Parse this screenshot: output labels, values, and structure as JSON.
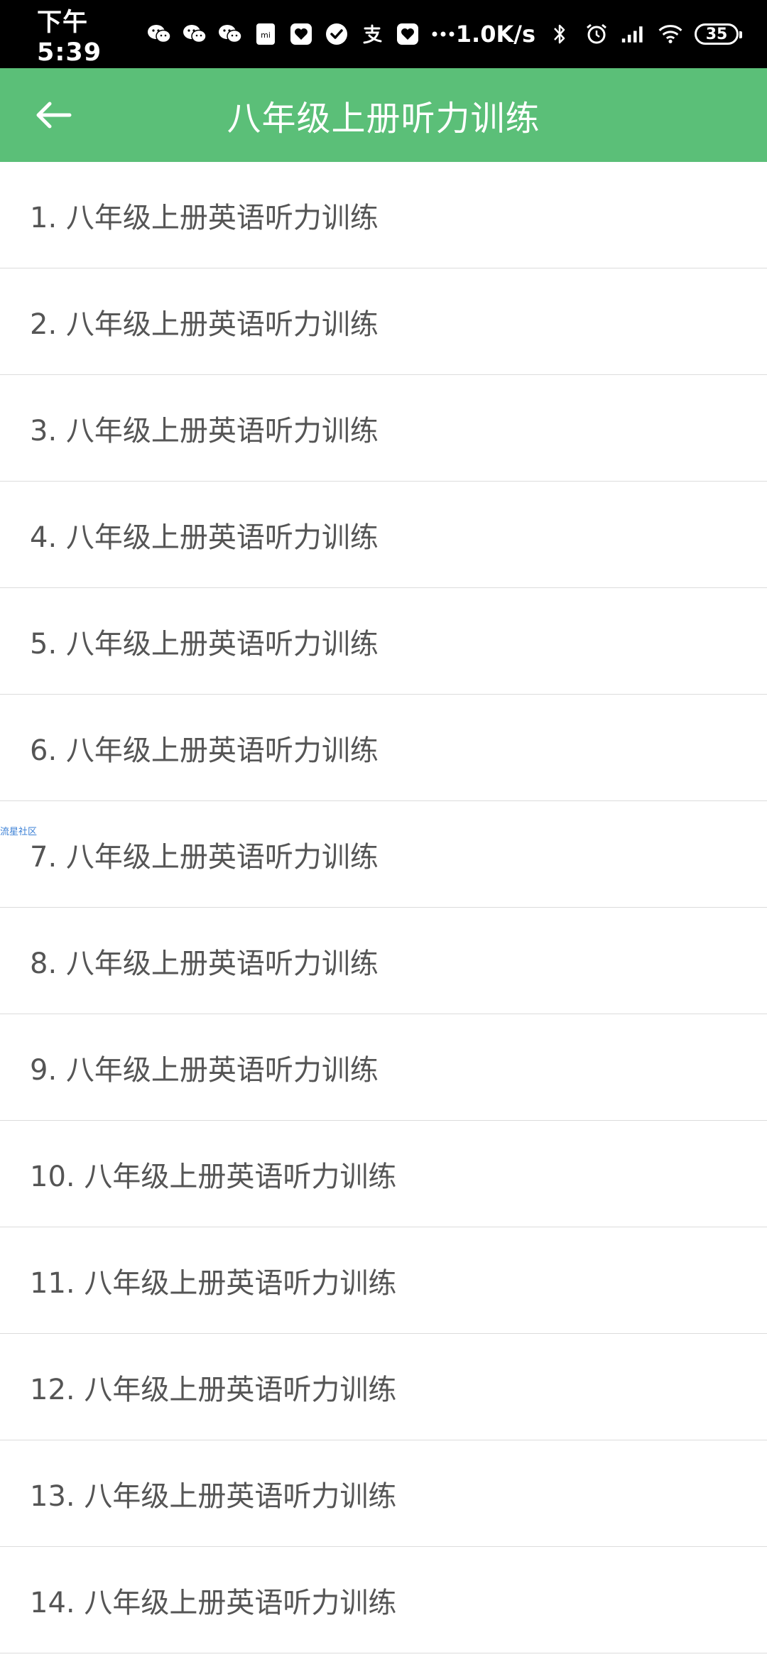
{
  "status_bar": {
    "time": "下午5:39",
    "speed": "1.0K/s",
    "battery": "35",
    "icons": [
      "wechat-icon",
      "wechat-icon",
      "wechat-icon",
      "mi-icon",
      "heart-app-icon",
      "check-circle-icon",
      "alipay-icon",
      "heart-app-icon",
      "more-dots-icon",
      "bluetooth-icon",
      "alarm-icon",
      "signal-icon",
      "wifi-icon",
      "battery-icon"
    ]
  },
  "app_bar": {
    "title": "八年级上册听力训练"
  },
  "list": {
    "items": [
      {
        "label": "1. 八年级上册英语听力训练"
      },
      {
        "label": "2. 八年级上册英语听力训练"
      },
      {
        "label": "3. 八年级上册英语听力训练"
      },
      {
        "label": "4. 八年级上册英语听力训练"
      },
      {
        "label": "5. 八年级上册英语听力训练"
      },
      {
        "label": "6. 八年级上册英语听力训练"
      },
      {
        "label": "7. 八年级上册英语听力训练"
      },
      {
        "label": "8. 八年级上册英语听力训练"
      },
      {
        "label": "9. 八年级上册英语听力训练"
      },
      {
        "label": "10. 八年级上册英语听力训练"
      },
      {
        "label": "11. 八年级上册英语听力训练"
      },
      {
        "label": "12. 八年级上册英语听力训练"
      },
      {
        "label": "13. 八年级上册英语听力训练"
      },
      {
        "label": "14. 八年级上册英语听力训练"
      }
    ]
  },
  "watermark": "流星社区",
  "colors": {
    "app_bar": "#5bbf78",
    "status_bar": "#000000",
    "item_text": "#555555",
    "divider": "#dcdcdc"
  }
}
